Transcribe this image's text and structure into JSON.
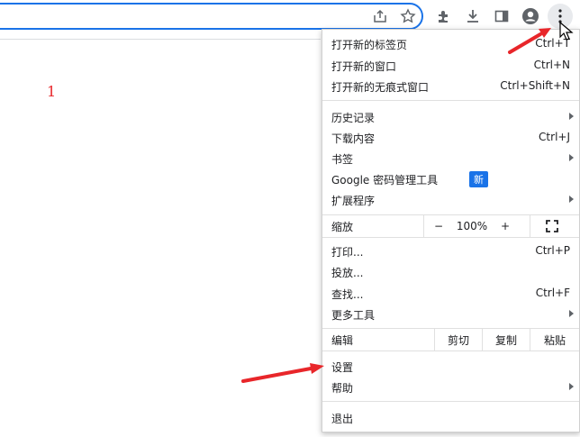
{
  "page": {
    "number": "1"
  },
  "menu": {
    "new_tab": {
      "label": "打开新的标签页",
      "shortcut": "Ctrl+T"
    },
    "new_window": {
      "label": "打开新的窗口",
      "shortcut": "Ctrl+N"
    },
    "new_incognito": {
      "label": "打开新的无痕式窗口",
      "shortcut": "Ctrl+Shift+N"
    },
    "history": {
      "label": "历史记录"
    },
    "downloads": {
      "label": "下载内容",
      "shortcut": "Ctrl+J"
    },
    "bookmarks": {
      "label": "书签"
    },
    "password_manager": {
      "label": "Google 密码管理工具",
      "badge": "新"
    },
    "extensions": {
      "label": "扩展程序"
    },
    "zoom": {
      "label": "缩放",
      "minus": "−",
      "value": "100%",
      "plus": "+"
    },
    "print": {
      "label": "打印...",
      "shortcut": "Ctrl+P"
    },
    "cast": {
      "label": "投放..."
    },
    "find": {
      "label": "查找...",
      "shortcut": "Ctrl+F"
    },
    "more_tools": {
      "label": "更多工具"
    },
    "edit": {
      "label": "编辑",
      "cut": "剪切",
      "copy": "复制",
      "paste": "粘贴"
    },
    "settings": {
      "label": "设置"
    },
    "help": {
      "label": "帮助"
    },
    "exit": {
      "label": "退出"
    }
  },
  "colors": {
    "accent": "#1a73e8",
    "arrow": "#e8262a"
  },
  "icons": [
    "share-icon",
    "star-icon",
    "extensions-icon",
    "download-icon",
    "sidepanel-icon",
    "profile-icon",
    "menu-dots-icon",
    "cursor-icon",
    "fullscreen-icon",
    "submenu-arrow-icon"
  ]
}
